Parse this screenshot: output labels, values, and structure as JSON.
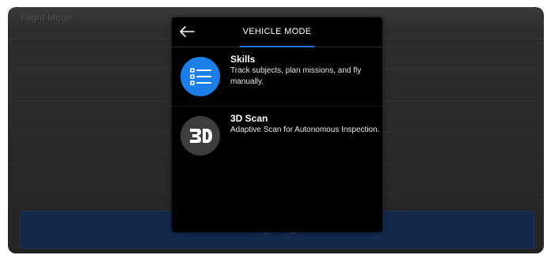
{
  "background": {
    "title": "Flight Mode",
    "begin_flight_label": "Begin Flight"
  },
  "dialog": {
    "back_icon": "arrow-left-icon",
    "title": "VEHICLE MODE",
    "items": [
      {
        "name": "Skills",
        "description": "Track subjects, plan missions, and fly manually.",
        "icon": "list-icon",
        "icon_color": "#1a7fe8"
      },
      {
        "name": "3D Scan",
        "description": "Adaptive Scan for Autonomous Inspection.",
        "icon": "3d-icon",
        "icon_color": "#3d3d3d"
      }
    ]
  },
  "colors": {
    "accent": "#1a73e8",
    "dialog_bg": "#000000",
    "button_bg": "#14284a"
  }
}
